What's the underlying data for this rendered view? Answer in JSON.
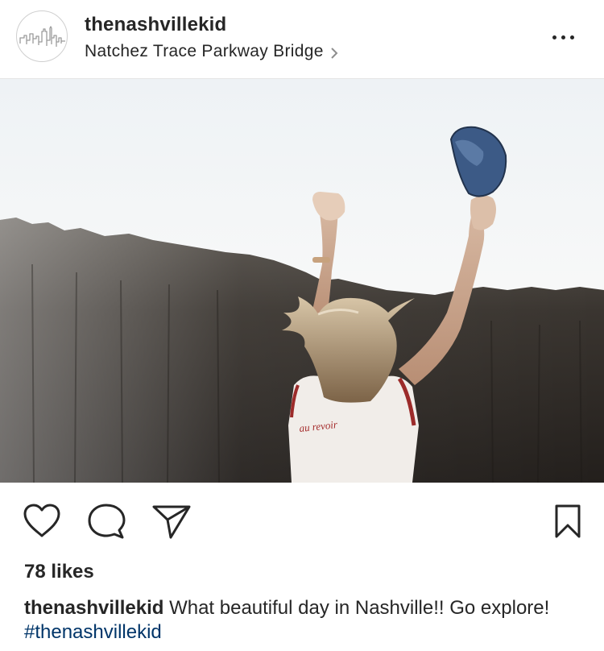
{
  "post": {
    "username": "thenashvillekid",
    "location": "Natchez Trace Parkway Bridge",
    "likes": "78 likes",
    "caption_user": "thenashvillekid",
    "caption_text": "What beautiful day in Nashville!! Go explore!",
    "caption_hashtag": "#thenashvillekid",
    "shirt_text": "au revoir"
  },
  "icons": {
    "avatar": "nashville-skyline-logo",
    "location_chevron": "chevron-right-icon",
    "more": "more-options-icon",
    "like": "heart-icon",
    "comment": "comment-icon",
    "share": "paper-plane-icon",
    "save": "bookmark-icon"
  },
  "colors": {
    "text": "#262626",
    "hashtag": "#003569",
    "divider": "#e6e6e6"
  }
}
